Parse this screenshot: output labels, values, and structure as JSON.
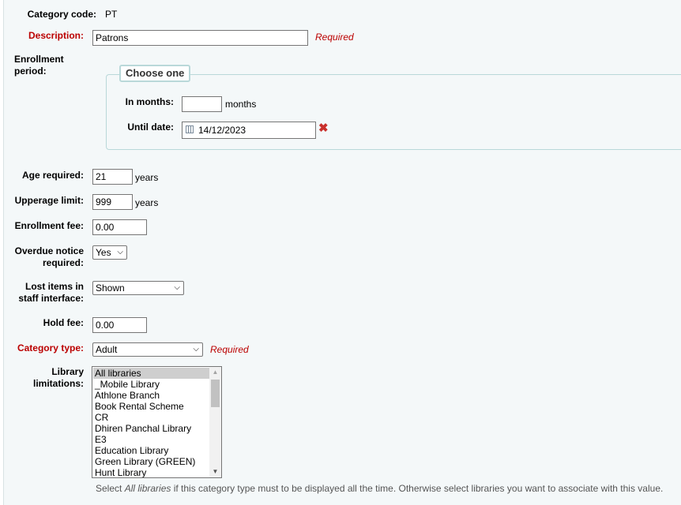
{
  "category_code": {
    "label": "Category code:",
    "value": "PT"
  },
  "description": {
    "label": "Description:",
    "value": "Patrons",
    "required": "Required"
  },
  "enrollment": {
    "label": "Enrollment period:",
    "legend": "Choose one",
    "months_label": "In months:",
    "months_value": "",
    "months_unit": "months",
    "until_label": "Until date:",
    "until_value": "14/12/2023"
  },
  "age_required": {
    "label": "Age required:",
    "value": "21",
    "unit": "years"
  },
  "upperage_limit": {
    "label": "Upperage limit:",
    "value": "999",
    "unit": "years"
  },
  "enrollment_fee": {
    "label": "Enrollment fee:",
    "value": "0.00"
  },
  "overdue_notice": {
    "label_line1": "Overdue notice",
    "label_line2": "required:",
    "value": "Yes"
  },
  "lost_items": {
    "label_line1": "Lost items in",
    "label_line2": "staff interface:",
    "value": "Shown"
  },
  "hold_fee": {
    "label": "Hold fee:",
    "value": "0.00"
  },
  "category_type": {
    "label": "Category type:",
    "value": "Adult",
    "required": "Required"
  },
  "library_limitations": {
    "label_line1": "Library",
    "label_line2": "limitations:",
    "options": [
      "All libraries",
      "_Mobile Library",
      "Athlone Branch",
      "Book Rental Scheme",
      "CR",
      "Dhiren Panchal Library",
      "E3",
      "Education Library",
      "Green Library (GREEN)",
      "Hunt Library"
    ],
    "selected": "All libraries",
    "hint_prefix": "Select ",
    "hint_em": "All libraries",
    "hint_suffix": " if this category type must to be displayed all the time. Otherwise select libraries you want to associate with this value."
  }
}
